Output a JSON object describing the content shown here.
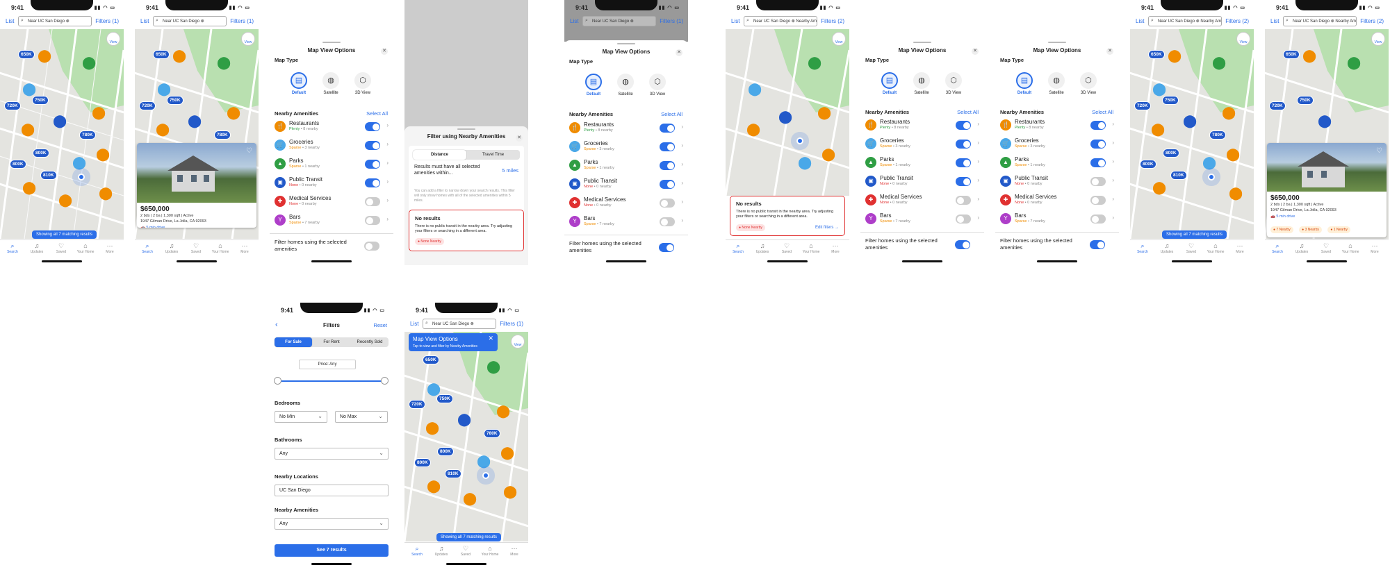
{
  "status": {
    "time": "9:41"
  },
  "search": {
    "list": "List",
    "query": "Near UC San Diego",
    "query2": "Nearby Am",
    "filters1": "Filters (1)",
    "filters2": "Filters (2)"
  },
  "view_label": "View",
  "prices": [
    "650K",
    "750K",
    "720K",
    "780K",
    "800K",
    "810K"
  ],
  "tabs": [
    "Search",
    "Updates",
    "Saved",
    "Your Home",
    "More"
  ],
  "matching": "Showing all 7 matching results",
  "listing": {
    "price": "$650,000",
    "details": "2 bds | 2 ba | 1,300 sqft | Active",
    "address": "1947 Gilman Drive, La Jolla, CA 92093",
    "drive": "5 min drive",
    "chips": [
      "7 Nearby",
      "3 Nearby",
      "1 Nearby"
    ]
  },
  "options": {
    "title": "Map View Options",
    "map_type": "Map Type",
    "types": [
      "Default",
      "Satellite",
      "3D View"
    ],
    "nearby": "Nearby Amenities",
    "select_all": "Select All",
    "amenities": [
      {
        "name": "Restaurants",
        "level": "Plenty",
        "count": "8 nearby",
        "color": "#f08c00"
      },
      {
        "name": "Groceries",
        "level": "Sparse",
        "count": "3 nearby",
        "color": "#4aa8e8"
      },
      {
        "name": "Parks",
        "level": "Sparse",
        "count": "1 nearby",
        "color": "#2f9e44"
      },
      {
        "name": "Public Transit",
        "level": "None",
        "count": "0 nearby",
        "color": "#2259c9"
      },
      {
        "name": "Medical Services",
        "level": "None",
        "count": "0 nearby",
        "color": "#e03131"
      },
      {
        "name": "Bars",
        "level": "Sparse",
        "count": "7 nearby",
        "color": "#ae3ec9"
      }
    ],
    "filter_homes": "Filter homes using the selected amenities"
  },
  "filter_sheet": {
    "title": "Filter using Nearby Amenities",
    "tabs": [
      "Distance",
      "Travel Time"
    ],
    "must": "Results must have all selected amenities within...",
    "miles": "5 miles",
    "help": "You can add a filter to narrow down your search results. This filter will only show homes with all of the selected amenities within 5 miles."
  },
  "no_results": {
    "title": "No results",
    "body": "There is no public transit in the nearby area. Try adjusting your filters or searching in a different area.",
    "chip": "None Nearby",
    "edit": "Edit filters"
  },
  "filters_page": {
    "title": "Filters",
    "reset": "Reset",
    "segments": [
      "For Sale",
      "For Rent",
      "Recently Sold"
    ],
    "price": "Price: Any",
    "bedrooms": "Bedrooms",
    "min": "No Min",
    "max": "No Max",
    "bathrooms": "Bathrooms",
    "any": "Any",
    "locations": "Nearby Locations",
    "location_value": "UC San Diego",
    "amenities": "Nearby Amenities",
    "amenities_value": "Any",
    "see": "See 7 results"
  },
  "tooltip": {
    "title": "Map View Options",
    "sub": "Tap to view and filter by Nearby Amenities"
  }
}
